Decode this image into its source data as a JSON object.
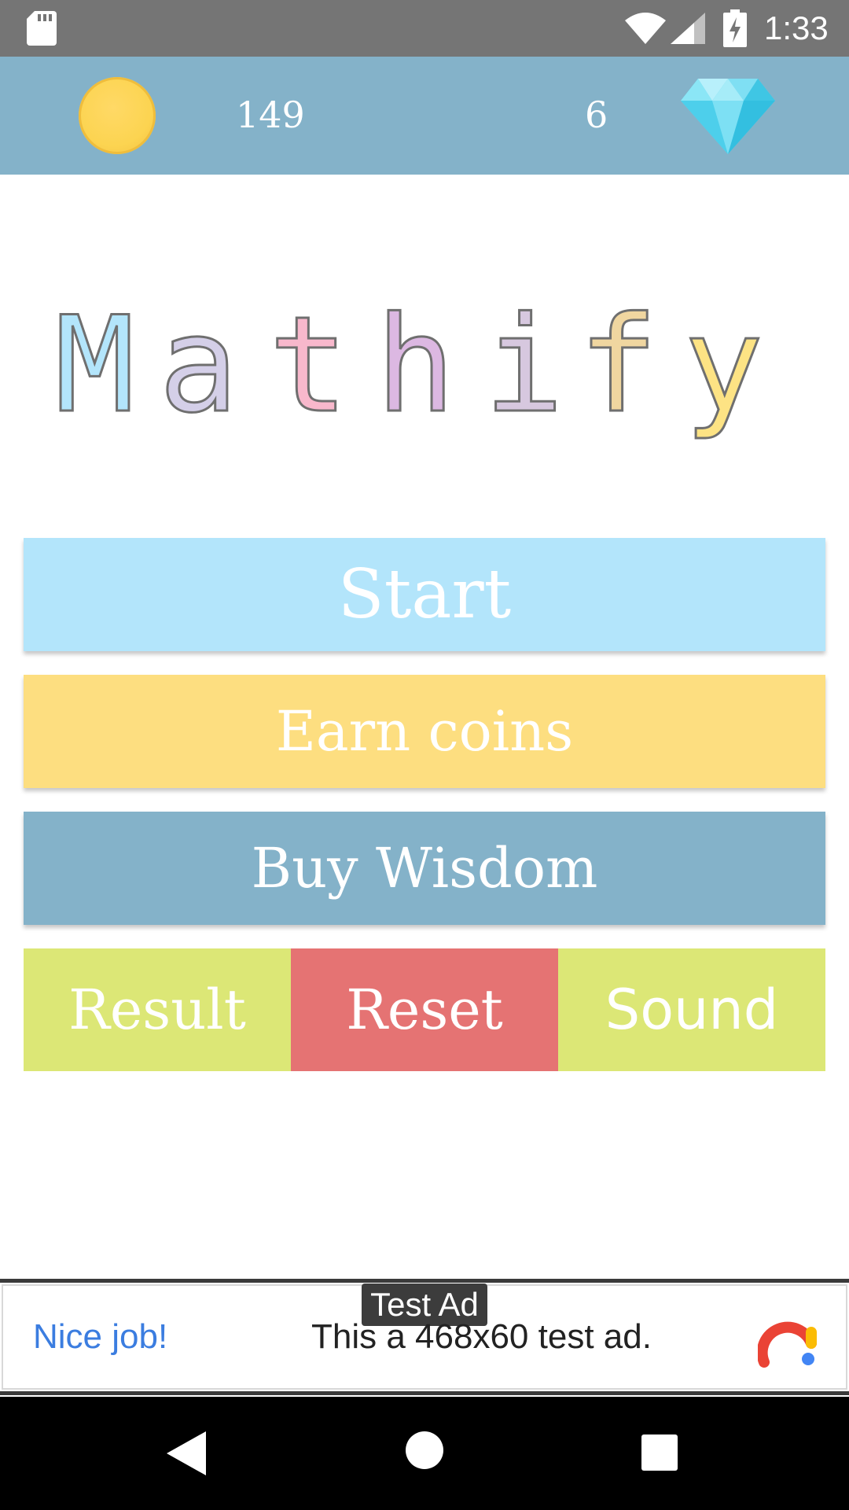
{
  "status_bar": {
    "time": "1:33",
    "icons": [
      "sd-card-icon",
      "wifi-icon",
      "signal-icon",
      "battery-charging-icon"
    ]
  },
  "currency": {
    "coins": "149",
    "gems": "6",
    "coin_icon": "coin-icon",
    "gem_icon": "diamond-icon"
  },
  "logo": {
    "letters": [
      {
        "char": "M",
        "color": "#b3e5fb"
      },
      {
        "char": "a",
        "color": "#d4cfe8"
      },
      {
        "char": "t",
        "color": "#f8b8cc"
      },
      {
        "char": "h",
        "color": "#dcb8e2"
      },
      {
        "char": "i",
        "color": "#d7c8df"
      },
      {
        "char": "f",
        "color": "#f0d6a0"
      },
      {
        "char": "y",
        "color": "#fde384"
      }
    ]
  },
  "buttons": {
    "start": "Start",
    "earn_coins": "Earn coins",
    "buy_wisdom": "Buy Wisdom",
    "result": "Result",
    "reset": "Reset",
    "sound": "Sound"
  },
  "colors": {
    "header": "#84b2c9",
    "start": "#b3e5fb",
    "earn": "#fdde80",
    "wisdom": "#84b2c9",
    "result_sound": "#dce776",
    "reset": "#e57373"
  },
  "ad": {
    "tag": "Test Ad",
    "headline": "Nice job!",
    "body": "This a 468x60 test ad."
  },
  "nav_bar": {
    "icons": [
      "back-icon",
      "home-icon",
      "recents-icon"
    ]
  }
}
